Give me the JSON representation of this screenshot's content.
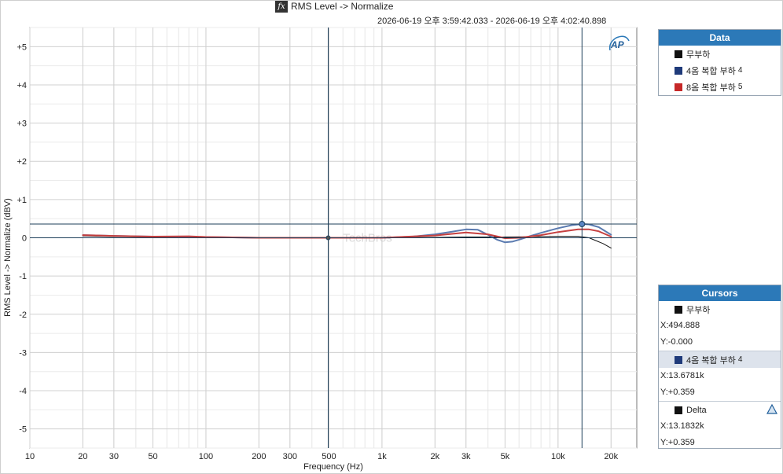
{
  "header": {
    "title": "RMS Level -> Normalize",
    "timestamp": "2026-06-19 오후 3:59:42.033 - 2026-06-19 오후 4:02:40.898",
    "logo_text": "AP",
    "watermark": "TechBros"
  },
  "legend_panel": {
    "title": "Data",
    "items": [
      {
        "label": "무부하",
        "suffix": "",
        "color": "#111111"
      },
      {
        "label": "4옴 복합 부하",
        "suffix": "4",
        "color": "#1f3a7a"
      },
      {
        "label": "8옴 복합 부하",
        "suffix": "5",
        "color": "#c62828"
      }
    ]
  },
  "cursors_panel": {
    "title": "Cursors",
    "cursor1": {
      "name": "무부하",
      "x": "X:494.888",
      "y": "Y:-0.000"
    },
    "cursor2": {
      "name": "4옴 복합 부하",
      "suffix": "4",
      "x": "X:13.6781k",
      "y": "Y:+0.359"
    },
    "delta": {
      "name": "Delta",
      "x": "X:13.1832k",
      "y": "Y:+0.359"
    }
  },
  "chart_data": {
    "type": "line",
    "xlabel": "Frequency (Hz)",
    "ylabel": "RMS Level -> Normalize (dBV)",
    "xscale": "log",
    "xlim": [
      10,
      28000
    ],
    "ylim": [
      -5.5,
      5.5
    ],
    "grid": true,
    "legend_position": "right",
    "x_ticks": [
      {
        "value": 10,
        "label": "10"
      },
      {
        "value": 20,
        "label": "20"
      },
      {
        "value": 30,
        "label": "30"
      },
      {
        "value": 50,
        "label": "50"
      },
      {
        "value": 100,
        "label": "100"
      },
      {
        "value": 200,
        "label": "200"
      },
      {
        "value": 300,
        "label": "300"
      },
      {
        "value": 500,
        "label": "500"
      },
      {
        "value": 1000,
        "label": "1k"
      },
      {
        "value": 2000,
        "label": "2k"
      },
      {
        "value": 3000,
        "label": "3k"
      },
      {
        "value": 5000,
        "label": "5k"
      },
      {
        "value": 10000,
        "label": "10k"
      },
      {
        "value": 20000,
        "label": "20k"
      }
    ],
    "y_ticks": [
      {
        "value": 5,
        "label": "+5"
      },
      {
        "value": 4,
        "label": "+4"
      },
      {
        "value": 3,
        "label": "+3"
      },
      {
        "value": 2,
        "label": "+2"
      },
      {
        "value": 1,
        "label": "+1"
      },
      {
        "value": 0,
        "label": "0"
      },
      {
        "value": -1,
        "label": "-1"
      },
      {
        "value": -2,
        "label": "-2"
      },
      {
        "value": -3,
        "label": "-3"
      },
      {
        "value": -4,
        "label": "-4"
      },
      {
        "value": -5,
        "label": "-5"
      }
    ],
    "series": [
      {
        "name": "무부하",
        "color": "#111111",
        "x": [
          20,
          30,
          50,
          100,
          200,
          500,
          1000,
          2000,
          3000,
          5000,
          8000,
          10000,
          13000,
          15000,
          18000,
          20000
        ],
        "y": [
          0.05,
          0.03,
          0.02,
          0.01,
          0.0,
          0.0,
          0.0,
          0.01,
          0.02,
          0.02,
          0.03,
          0.04,
          0.04,
          0.0,
          -0.15,
          -0.27
        ]
      },
      {
        "name": "4옴 복합 부하",
        "color": "#5b7bb0",
        "x": [
          20,
          30,
          50,
          100,
          200,
          500,
          1000,
          1500,
          2000,
          2500,
          3000,
          3500,
          4000,
          4500,
          5000,
          5500,
          6000,
          7000,
          8000,
          10000,
          12000,
          13700,
          15000,
          17000,
          20000
        ],
        "y": [
          0.07,
          0.05,
          0.03,
          0.02,
          0.0,
          0.0,
          0.0,
          0.03,
          0.09,
          0.16,
          0.22,
          0.21,
          0.08,
          -0.05,
          -0.12,
          -0.1,
          -0.05,
          0.05,
          0.13,
          0.25,
          0.33,
          0.359,
          0.35,
          0.28,
          0.08
        ]
      },
      {
        "name": "8옴 복합 부하",
        "color": "#c64040",
        "x": [
          20,
          30,
          50,
          80,
          100,
          200,
          500,
          1000,
          2000,
          3000,
          4000,
          5000,
          6000,
          8000,
          10000,
          13000,
          15000,
          17000,
          20000
        ],
        "y": [
          0.07,
          0.05,
          0.03,
          0.04,
          0.02,
          0.0,
          0.0,
          0.0,
          0.06,
          0.14,
          0.09,
          -0.01,
          0.0,
          0.07,
          0.15,
          0.22,
          0.22,
          0.17,
          0.03
        ]
      }
    ],
    "cursors": [
      {
        "x": 494.888,
        "y": 0.0
      },
      {
        "x": 13678.1,
        "y": 0.359
      }
    ]
  }
}
